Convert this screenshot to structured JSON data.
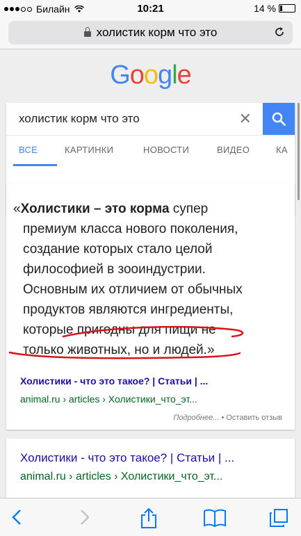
{
  "status": {
    "carrier": "Билайн",
    "time": "10:21",
    "battery": "14 %"
  },
  "url_bar": {
    "text": "холистик корм что это"
  },
  "logo": {
    "letters": [
      "G",
      "o",
      "o",
      "g",
      "l",
      "e"
    ]
  },
  "search": {
    "query": "холистик корм что это",
    "tabs": [
      "ВСЕ",
      "КАРТИНКИ",
      "НОВОСТИ",
      "ВИДЕО",
      "КА"
    ]
  },
  "snippet": {
    "lines": [
      [
        "«",
        "Холистики – это корма",
        " супер"
      ],
      "премиум класса нового поколения,",
      "создание которых стало целой",
      "философией в зооиндустрии.",
      "Основным их отличием от обычных",
      "продуктов являются ингредиенты,",
      "которые пригодны для пищи не",
      "только животных, но и людей.»"
    ],
    "result_title": "Холистики - что это такое? | Статьи | ...",
    "result_url": "animal.ru › articles › Холистики_что_эт...",
    "more": "Подробнее...",
    "feedback": "• Оставить отзыв"
  },
  "result2": {
    "title": "Холистики - что это такое? | Статьи | ...",
    "url": "animal.ru › articles › Холистики_что_эт..."
  },
  "colors": {
    "accent": "#4285f4",
    "link": "#1a0dab",
    "url": "#006621",
    "ios_blue": "#007aff"
  }
}
